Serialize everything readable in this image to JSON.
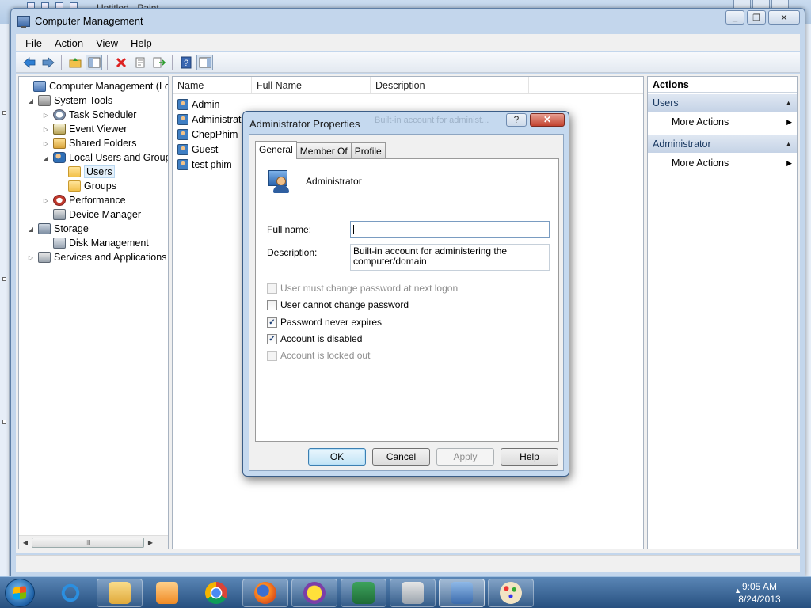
{
  "paint_window": {
    "title": "Untitled - Paint"
  },
  "window": {
    "title": "Computer Management",
    "minimize": "_",
    "restore": "❐",
    "close": "✕"
  },
  "menu": [
    "File",
    "Action",
    "View",
    "Help"
  ],
  "toolbar": {
    "icons": [
      "back-arrow-icon",
      "forward-arrow-icon",
      "up-folder-icon",
      "show-hide-tree-icon",
      "delete-icon",
      "properties-icon",
      "export-list-icon",
      "help-icon",
      "show-hide-action-pane-icon"
    ]
  },
  "tree": {
    "items": [
      {
        "label": "Computer Management (Local",
        "icon": "computer-icon",
        "expander": ""
      },
      {
        "label": "System Tools",
        "icon": "tools-icon",
        "expander": "◢"
      },
      {
        "label": "Task Scheduler",
        "icon": "clock-icon",
        "expander": "▷"
      },
      {
        "label": "Event Viewer",
        "icon": "event-viewer-icon",
        "expander": "▷"
      },
      {
        "label": "Shared Folders",
        "icon": "shared-folder-icon",
        "expander": "▷"
      },
      {
        "label": "Local Users and Groups",
        "icon": "users-icon",
        "expander": "◢"
      },
      {
        "label": "Users",
        "icon": "folder-icon",
        "expander": ""
      },
      {
        "label": "Groups",
        "icon": "folder-icon",
        "expander": ""
      },
      {
        "label": "Performance",
        "icon": "performance-icon",
        "expander": "▷"
      },
      {
        "label": "Device Manager",
        "icon": "device-manager-icon",
        "expander": ""
      },
      {
        "label": "Storage",
        "icon": "storage-icon",
        "expander": "◢"
      },
      {
        "label": "Disk Management",
        "icon": "disk-icon",
        "expander": ""
      },
      {
        "label": "Services and Applications",
        "icon": "services-icon",
        "expander": "▷"
      }
    ],
    "scroll_thumb": "III"
  },
  "list": {
    "columns": [
      "Name",
      "Full Name",
      "Description"
    ],
    "rows": [
      "Admin",
      "Administrator",
      "ChepPhim",
      "Guest",
      "test phim"
    ]
  },
  "actions": {
    "header": "Actions",
    "sections": [
      {
        "title": "Users",
        "item": "More Actions"
      },
      {
        "title": "Administrator",
        "item": "More Actions"
      }
    ]
  },
  "dialog": {
    "title": "Administrator Properties",
    "ghost_text": "Built-in account for administ...",
    "help_btn": "?",
    "close_btn": "✕",
    "tabs": [
      "General",
      "Member Of",
      "Profile"
    ],
    "user_name": "Administrator",
    "full_name_label": "Full name:",
    "full_name_value": "",
    "description_label": "Description:",
    "description_value": "Built-in account for administering the computer/domain",
    "checkboxes": [
      {
        "label": "User must change password at next logon",
        "checked": false,
        "disabled": true
      },
      {
        "label": "User cannot change password",
        "checked": false,
        "disabled": false
      },
      {
        "label": "Password never expires",
        "checked": true,
        "disabled": false
      },
      {
        "label": "Account is disabled",
        "checked": true,
        "disabled": false
      },
      {
        "label": "Account is locked out",
        "checked": false,
        "disabled": true
      }
    ],
    "buttons": {
      "ok": "OK",
      "cancel": "Cancel",
      "apply": "Apply",
      "help": "Help"
    }
  },
  "taskbar": {
    "apps": [
      "internet-explorer-icon",
      "file-explorer-icon",
      "media-player-icon",
      "chrome-icon",
      "firefox-icon",
      "yahoo-messenger-icon",
      "excel-icon",
      "usb-drive-icon",
      "computer-management-icon",
      "paint-icon"
    ],
    "time": "9:05 AM",
    "date": "8/24/2013",
    "tray_arrow": "▲"
  }
}
